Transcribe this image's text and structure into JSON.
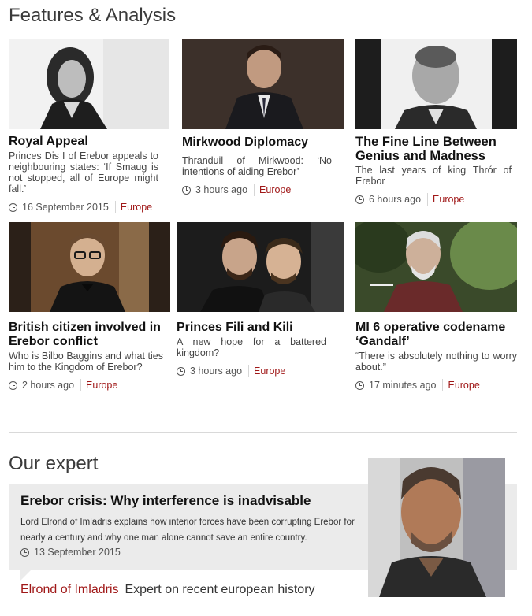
{
  "features": {
    "heading": "Features & Analysis",
    "cards": [
      {
        "title": "Royal Appeal",
        "summary": "Princes Dis I of Erebor appeals to neighbouring states: ‘If Smaug is not stopped, all of Europe might fall.’",
        "time": "16 September 2015",
        "tag": "Europe"
      },
      {
        "title": "Mirkwood Diplomacy",
        "summary": "Thranduil of Mirkwood: ‘No intentions of aiding Erebor’",
        "time": "3 hours ago",
        "tag": "Europe"
      },
      {
        "title": "The Fine Line Between Genius and Madness",
        "summary": "The last years of king Thrór of Erebor",
        "time": "6 hours ago",
        "tag": "Europe"
      },
      {
        "title": "British citizen involved in Erebor conflict",
        "summary": "Who is Bilbo Baggins and what ties him to the Kingdom of Erebor?",
        "time": "2 hours ago",
        "tag": "Europe"
      },
      {
        "title": "Princes Fili and Kili",
        "summary": "A new hope for a battered kingdom?",
        "time": "3 hours ago",
        "tag": "Europe"
      },
      {
        "title": "MI 6 operative codename ‘Gandalf’",
        "summary": "“There is absolutely nothing to worry about.”",
        "time": "17 minutes ago",
        "tag": "Europe"
      }
    ]
  },
  "expert": {
    "heading": "Our expert",
    "headline": "Erebor crisis: Why interference is inadvisable",
    "summary": "Lord Elrond of Imladris explains how interior forces have been corrupting Erebor for nearly a century and why one man alone cannot save an entire country.",
    "date": "13 September 2015",
    "name": "Elrond of Imladris",
    "role": "Expert on recent european history"
  }
}
